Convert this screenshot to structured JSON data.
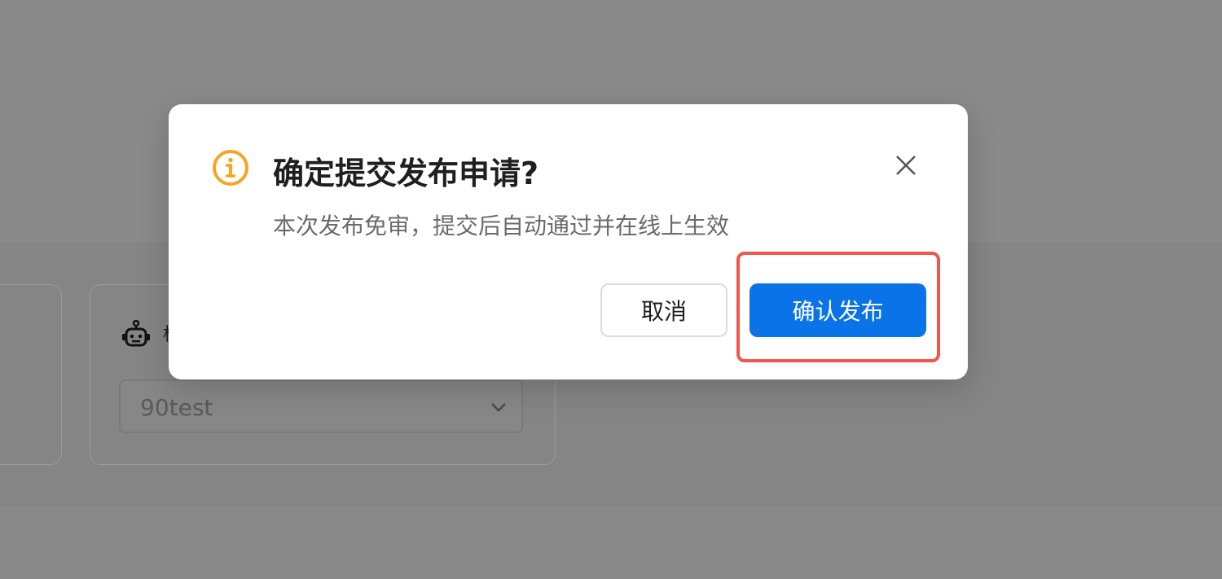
{
  "background": {
    "label_fragment": "标",
    "select": {
      "value": "90test"
    }
  },
  "dialog": {
    "title": "确定提交发布申请?",
    "description": "本次发布免审，提交后自动通过并在线上生效",
    "cancel_label": "取消",
    "confirm_label": "确认发布",
    "icon": "info-circle-icon",
    "close_icon": "close-icon"
  },
  "colors": {
    "overlay": "#8a8a8a",
    "warning_icon": "#f5a623",
    "primary": "#0a73e8",
    "highlight": "#f0564c"
  }
}
